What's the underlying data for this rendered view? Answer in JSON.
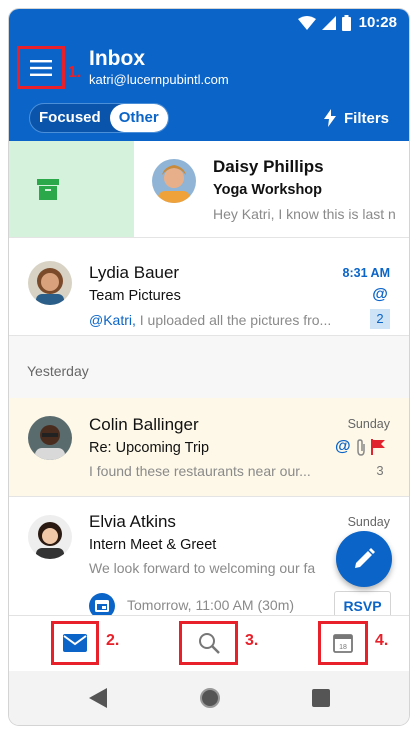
{
  "status_bar": {
    "time": "10:28"
  },
  "header": {
    "title": "Inbox",
    "account": "katri@lucernpubintl.com",
    "tabs": [
      {
        "label": "Focused"
      },
      {
        "label": "Other"
      }
    ],
    "filters_label": "Filters"
  },
  "markers": {
    "menu": "1.",
    "mail": "2.",
    "search": "3.",
    "calendar": "4."
  },
  "messages": [
    {
      "sender": "Daisy Phillips",
      "subject": "Yoga Workshop",
      "preview": "Hey Katri, I know this is last n",
      "time": "",
      "swipe_action_icon": "archive-icon"
    },
    {
      "sender": "Lydia Bauer",
      "subject": "Team Pictures",
      "mention": "@Katri,",
      "preview": " I uploaded all the pictures fro...",
      "time": "8:31 AM",
      "at_badge": "@",
      "count": "2"
    },
    {
      "sender": "Colin Ballinger",
      "subject": "Re: Upcoming Trip",
      "preview": "I found these restaurants near our...",
      "time": "Sunday",
      "count": "3",
      "icons": [
        "at-icon",
        "attachment-icon",
        "flag-icon"
      ]
    },
    {
      "sender": "Elvia Atkins",
      "subject": "Intern Meet & Greet",
      "preview": "We look forward to welcoming our fa",
      "time": "Sunday",
      "event_time": "Tomorrow, 11:00 AM (30m)",
      "rsvp_label": "RSVP"
    }
  ],
  "section": {
    "label": "Yesterday"
  },
  "colors": {
    "brand": "#0b64c7",
    "marker": "#e8202a",
    "flag": "#e0232e",
    "highlight_row": "#fdf8e8",
    "swipe_green": "#d5f2dc"
  }
}
